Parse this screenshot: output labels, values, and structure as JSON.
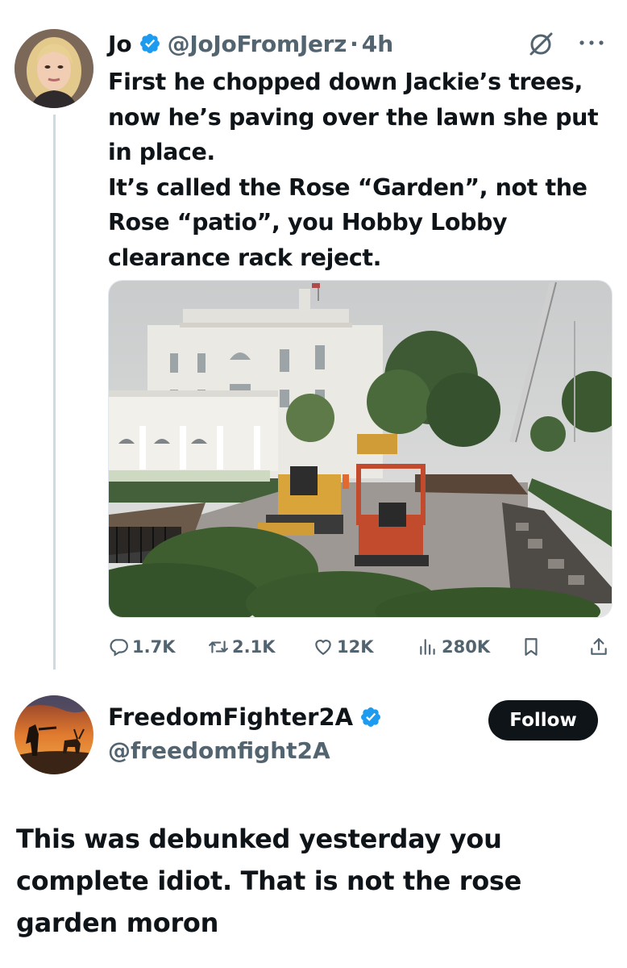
{
  "tweet": {
    "author_name": "Jo",
    "author_handle": "@JoJoFromJerz",
    "separator": "·",
    "time": "4h",
    "avatar_icon": "woman-portrait-avatar",
    "more_icon": "ellipsis-icon",
    "grok_icon": "grok-icon",
    "text_lines": [
      "First he chopped down Jackie’s trees, now he’s paving over the lawn she put in place.",
      "It’s called the Rose “Garden”, not the Rose “patio”, you Hobby Lobby clearance rack reject."
    ],
    "photo_description_icon": "white-house-construction-photo",
    "stats": {
      "replies": "1.7K",
      "reposts": "2.1K",
      "likes": "12K",
      "views": "280K"
    },
    "colors": {
      "verified": "#1d9bf0",
      "muted": "#536471",
      "text": "#0f1419"
    }
  },
  "reply": {
    "author_name": "FreedomFighter2A",
    "author_handle": "@freedomfight2A",
    "follow_label": "Follow",
    "avatar_icon": "hunter-deer-sunset-avatar",
    "text": "This was debunked yesterday you complete idiot. That is not the rose garden moron"
  }
}
